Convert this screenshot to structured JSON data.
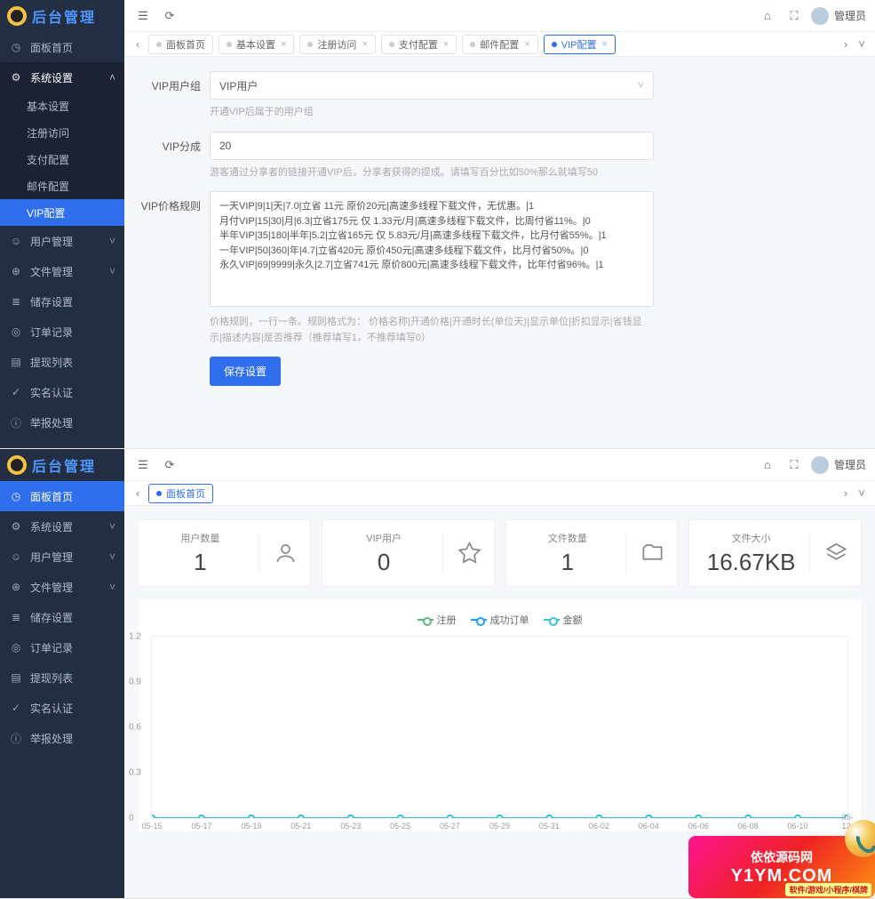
{
  "brand": "后台管理",
  "user": "管理员",
  "panel1": {
    "nav": {
      "home": "面板首页",
      "sys": "系统设置",
      "sys_sub": [
        "基本设置",
        "注册访问",
        "支付配置",
        "邮件配置",
        "VIP配置"
      ],
      "users": "用户管理",
      "files": "文件管理",
      "storage": "储存设置",
      "orders": "订单记录",
      "withdraw": "提现列表",
      "realname": "实名认证",
      "report": "举报处理"
    },
    "tabs": [
      "面板首页",
      "基本设置",
      "注册访问",
      "支付配置",
      "邮件配置",
      "VIP配置"
    ],
    "active_tab": "VIP配置",
    "form": {
      "group_label": "VIP用户组",
      "group_value": "VIP用户",
      "group_help": "开通VIP后属于的用户组",
      "share_label": "VIP分成",
      "share_value": "20",
      "share_help": "游客通过分享者的链接开通VIP后，分享者获得的提成。请填写百分比如50%那么就填写50",
      "rule_label": "VIP价格规则",
      "rule_value": "一天VIP|9|1|天|7.0|立省 11元 原价20元|高速多线程下载文件，无优惠。|1\n月付VIP|15|30|月|6.3|立省175元 仅 1.33元/月|高速多线程下载文件，比周付省11%。|0\n半年VIP|35|180|半年|5.2|立省165元 仅 5.83元/月|高速多线程下载文件，比月付省55%。|1\n一年VIP|50|360|年|4.7|立省420元 原价450元|高速多线程下载文件，比月付省50%。|0\n永久VIP|69|9999|永久|2.7|立省741元 原价800元|高速多线程下载文件，比年付省96%。|1",
      "rule_help": "价格规则，一行一条。规则格式为： 价格名称|开通价格|开通时长(单位天)|显示单位|折扣显示|省钱显示|描述内容|是否推荐（推荐填写1，不推荐填写0）",
      "submit": "保存设置"
    }
  },
  "panel2": {
    "nav": {
      "home": "面板首页",
      "sys": "系统设置",
      "users": "用户管理",
      "files": "文件管理",
      "storage": "储存设置",
      "orders": "订单记录",
      "withdraw": "提现列表",
      "realname": "实名认证",
      "report": "举报处理"
    },
    "tabs": [
      "面板首页"
    ],
    "stats": [
      {
        "title": "用户数量",
        "value": "1"
      },
      {
        "title": "VIP用户",
        "value": "0"
      },
      {
        "title": "文件数量",
        "value": "1"
      },
      {
        "title": "文件大小",
        "value": "16.67KB"
      }
    ],
    "legend": [
      "注册",
      "成功订单",
      "金额"
    ]
  },
  "chart_data": {
    "type": "line",
    "categories": [
      "05-15",
      "05-17",
      "05-19",
      "05-21",
      "05-23",
      "05-25",
      "05-27",
      "05-29",
      "05-31",
      "06-02",
      "06-04",
      "06-06",
      "06-08",
      "06-10",
      "06-12"
    ],
    "series": [
      {
        "name": "注册",
        "values": [
          0,
          0,
          0,
          0,
          0,
          0,
          0,
          0,
          0,
          0,
          0,
          0,
          0,
          0,
          0
        ]
      },
      {
        "name": "成功订单",
        "values": [
          0,
          0,
          0,
          0,
          0,
          0,
          0,
          0,
          0,
          0,
          0,
          0,
          0,
          0,
          0
        ]
      },
      {
        "name": "金额",
        "values": [
          0,
          0,
          0,
          0,
          0,
          0,
          0,
          0,
          0,
          0,
          0,
          0,
          0,
          0,
          0
        ]
      }
    ],
    "yticks": [
      0,
      0.3,
      0.6,
      0.9,
      1.2
    ],
    "ylim": [
      0,
      1.2
    ]
  },
  "watermark": {
    "line1": "依依源码网",
    "line2": "Y1YM.COM",
    "line3": "软件/游戏/小程序/棋牌"
  }
}
